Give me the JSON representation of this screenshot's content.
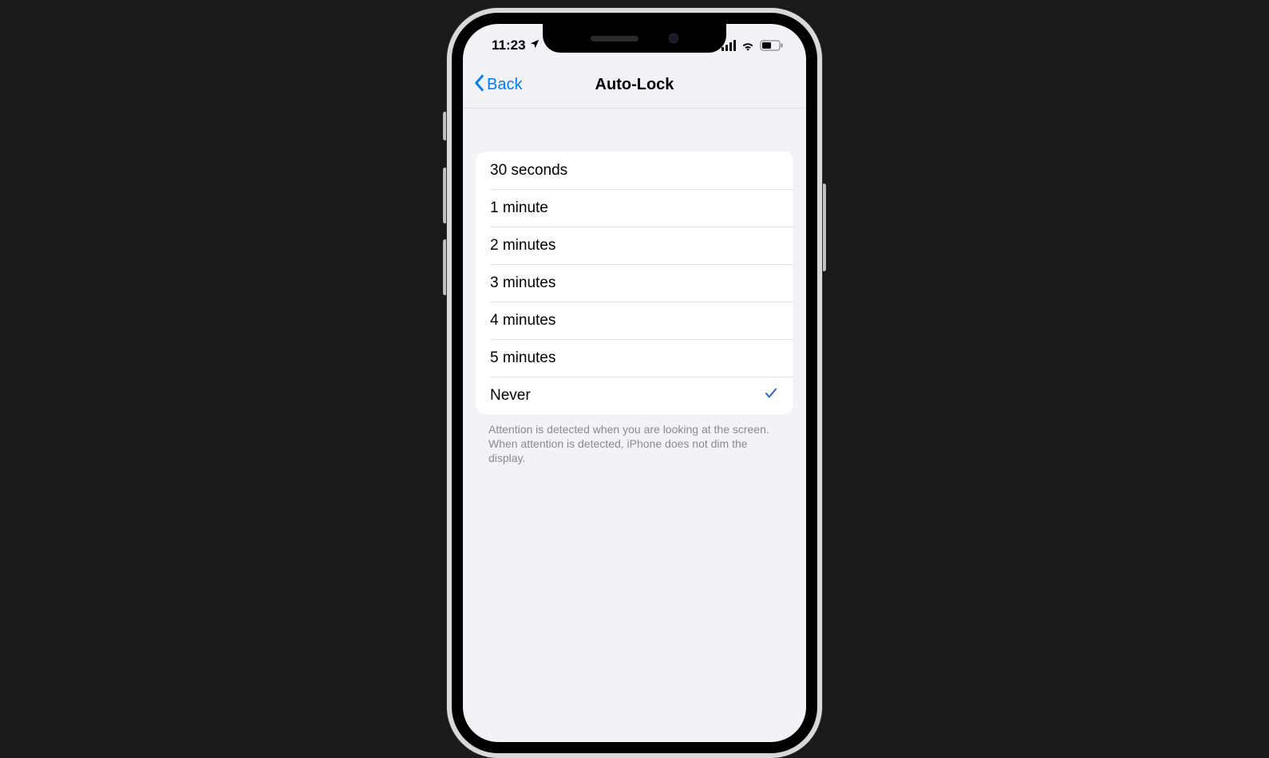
{
  "status": {
    "time": "11:23"
  },
  "nav": {
    "back_label": "Back",
    "title": "Auto-Lock"
  },
  "options": [
    {
      "label": "30 seconds",
      "selected": false
    },
    {
      "label": "1 minute",
      "selected": false
    },
    {
      "label": "2 minutes",
      "selected": false
    },
    {
      "label": "3 minutes",
      "selected": false
    },
    {
      "label": "4 minutes",
      "selected": false
    },
    {
      "label": "5 minutes",
      "selected": false
    },
    {
      "label": "Never",
      "selected": true
    }
  ],
  "footer": "Attention is detected when you are looking at the screen. When attention is detected, iPhone does not dim the display."
}
